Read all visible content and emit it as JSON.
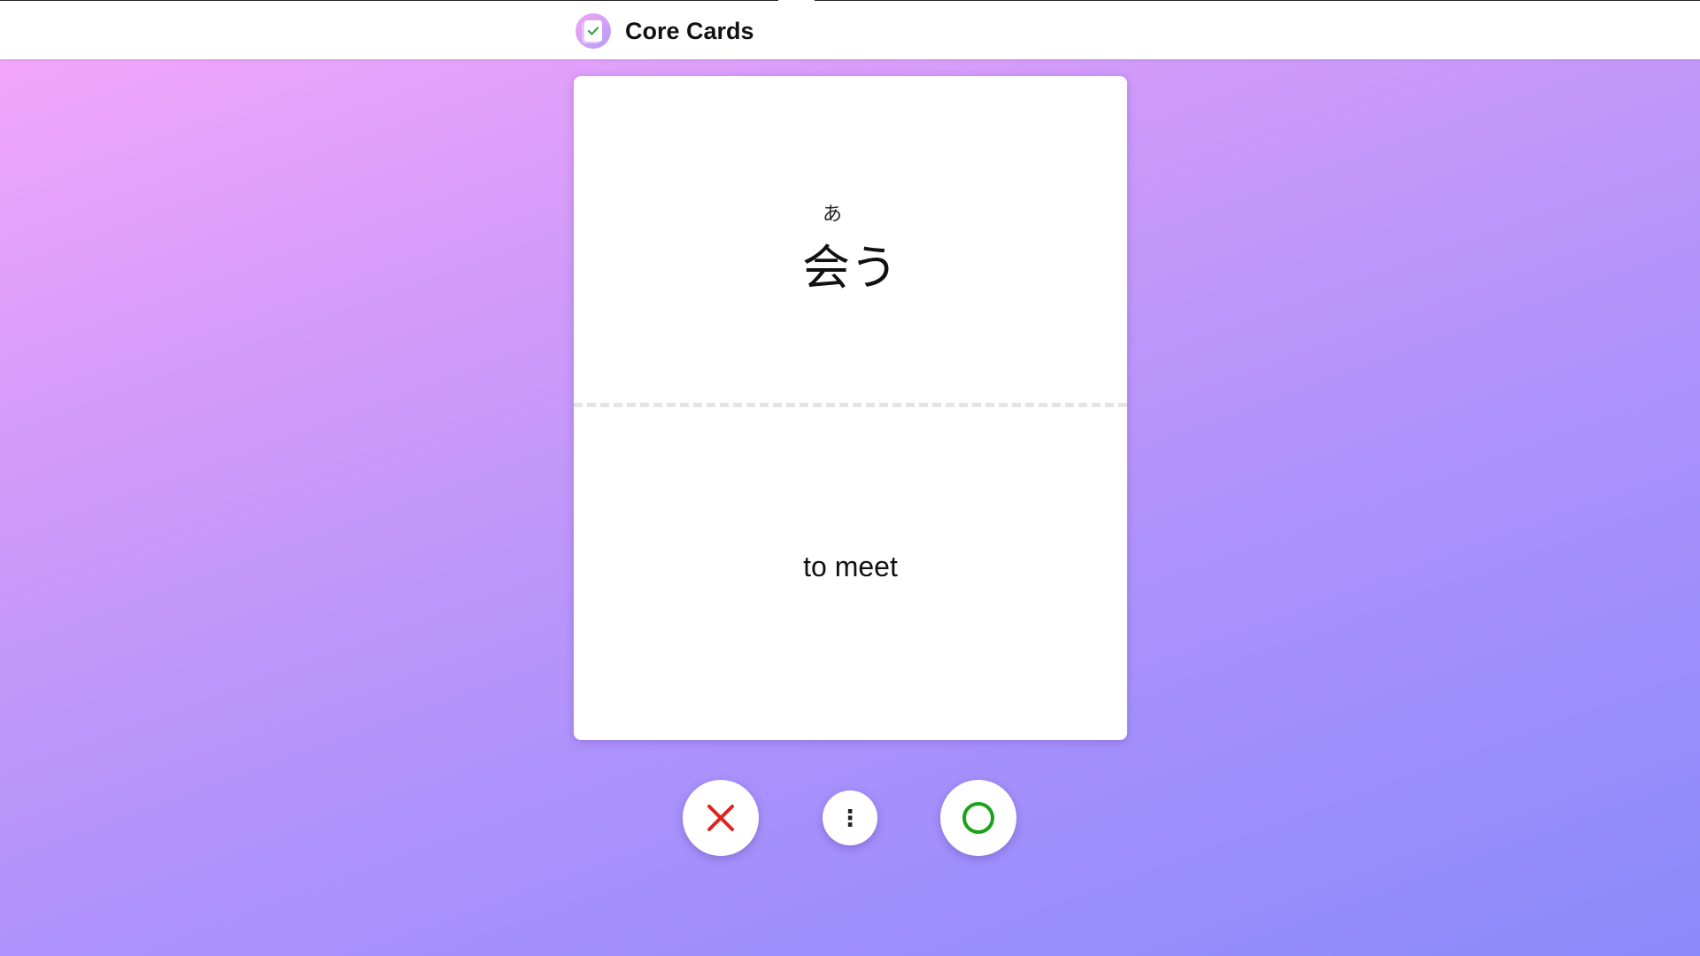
{
  "header": {
    "app_title": "Core Cards",
    "logo_icon": "flashcard-check-icon"
  },
  "card": {
    "reading": "あ",
    "word": "会う",
    "meaning": "to meet"
  },
  "actions": {
    "wrong_icon": "x-icon",
    "wrong_color": "#e0231f",
    "more_icon": "vertical-ellipsis-icon",
    "more_glyph": "⋮",
    "correct_icon": "circle-icon",
    "correct_color": "#1aa21a"
  }
}
